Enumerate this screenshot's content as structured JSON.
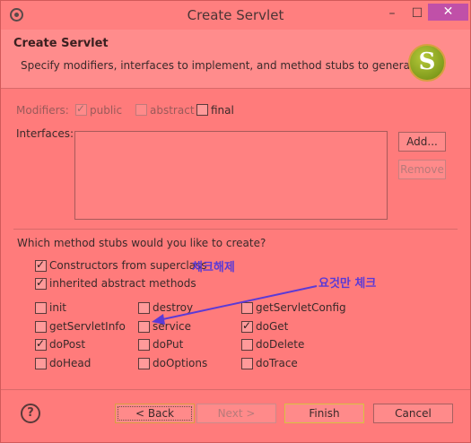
{
  "window": {
    "title": "Create Servlet",
    "minimize_glyph": "–",
    "maximize_glyph": "☐",
    "close_glyph": "✕"
  },
  "header": {
    "title": "Create Servlet",
    "description": "Specify modifiers, interfaces to implement, and method stubs to generate.",
    "logo_letter": "S"
  },
  "modifiers": {
    "label": "Modifiers:",
    "options": [
      {
        "label": "public",
        "checked": true,
        "enabled": false
      },
      {
        "label": "abstract",
        "checked": false,
        "enabled": false
      },
      {
        "label": "final",
        "checked": false,
        "enabled": true
      }
    ]
  },
  "interfaces": {
    "label": "Interfaces:",
    "items": [],
    "add_label": "Add...",
    "remove_label": "Remove"
  },
  "stubs": {
    "question": "Which method stubs would you like to create?",
    "constructors_label": "Constructors from superclass",
    "constructors_checked": true,
    "inherited_label": "inherited abstract methods",
    "inherited_checked": true,
    "methods": [
      {
        "label": "init",
        "checked": false
      },
      {
        "label": "destroy",
        "checked": false
      },
      {
        "label": "getServletConfig",
        "checked": false
      },
      {
        "label": "getServletInfo",
        "checked": false
      },
      {
        "label": "service",
        "checked": false
      },
      {
        "label": "doGet",
        "checked": true
      },
      {
        "label": "doPost",
        "checked": true
      },
      {
        "label": "doPut",
        "checked": false
      },
      {
        "label": "doDelete",
        "checked": false
      },
      {
        "label": "doHead",
        "checked": false
      },
      {
        "label": "doOptions",
        "checked": false
      },
      {
        "label": "doTrace",
        "checked": false
      }
    ]
  },
  "annotations": {
    "uncheck_note": "체크해제",
    "check_only_note": "요것만 체크",
    "arrow_color": "#5b3ad6"
  },
  "footer": {
    "help_glyph": "?",
    "back_label": "< Back",
    "next_label": "Next >",
    "finish_label": "Finish",
    "cancel_label": "Cancel"
  },
  "colors": {
    "background": "#ff7b7b",
    "annotation_blue": "#5b3ad6",
    "close_button": "#c050a8"
  }
}
